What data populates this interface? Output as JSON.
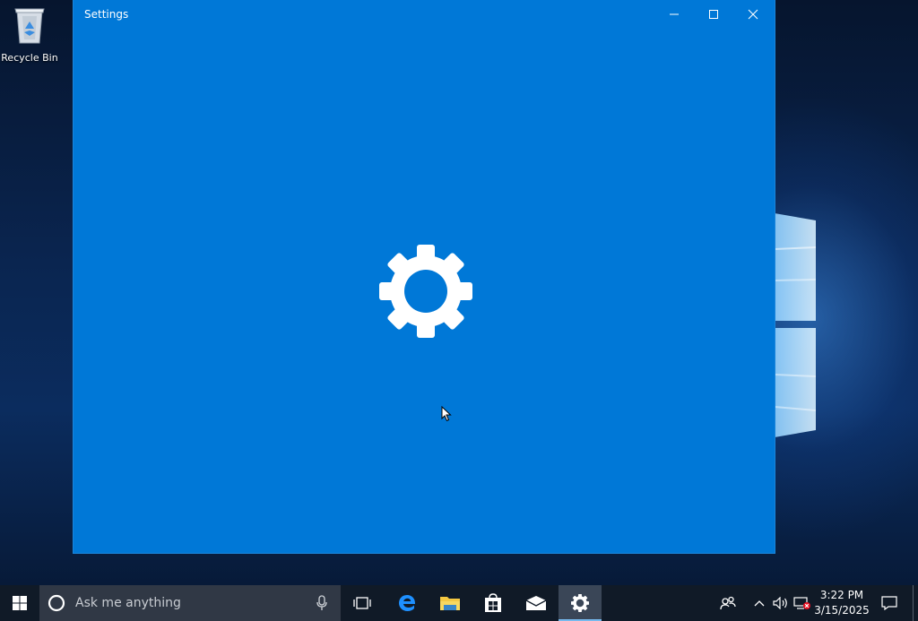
{
  "desktop": {
    "icons": [
      {
        "label": "Recycle Bin",
        "icon": "recycle-bin-icon"
      }
    ]
  },
  "window": {
    "title": "Settings",
    "background_color": "#0078d7",
    "splash_icon": "gear-icon",
    "caption_buttons": [
      "minimize-icon",
      "maximize-icon",
      "close-icon"
    ]
  },
  "taskbar": {
    "background_color": "#101a27",
    "start_icon": "windows-logo-icon",
    "search": {
      "placeholder": "Ask me anything",
      "left_icon": "cortana-icon",
      "right_icon": "microphone-icon"
    },
    "pinned": [
      {
        "name": "Task View",
        "icon": "task-view-icon",
        "active": false
      },
      {
        "name": "Microsoft Edge",
        "icon": "edge-icon",
        "active": false
      },
      {
        "name": "File Explorer",
        "icon": "folder-icon",
        "active": false
      },
      {
        "name": "Store",
        "icon": "store-icon",
        "active": false
      },
      {
        "name": "Mail",
        "icon": "mail-icon",
        "active": false
      },
      {
        "name": "Settings",
        "icon": "gear-icon",
        "active": true
      }
    ],
    "tray": {
      "icons": [
        "people-icon",
        "chevron-up-icon",
        "volume-icon",
        "network-disconnected-icon"
      ],
      "time": "3:22 PM",
      "date": "3/15/2025",
      "action_center_icon": "notification-icon"
    }
  }
}
